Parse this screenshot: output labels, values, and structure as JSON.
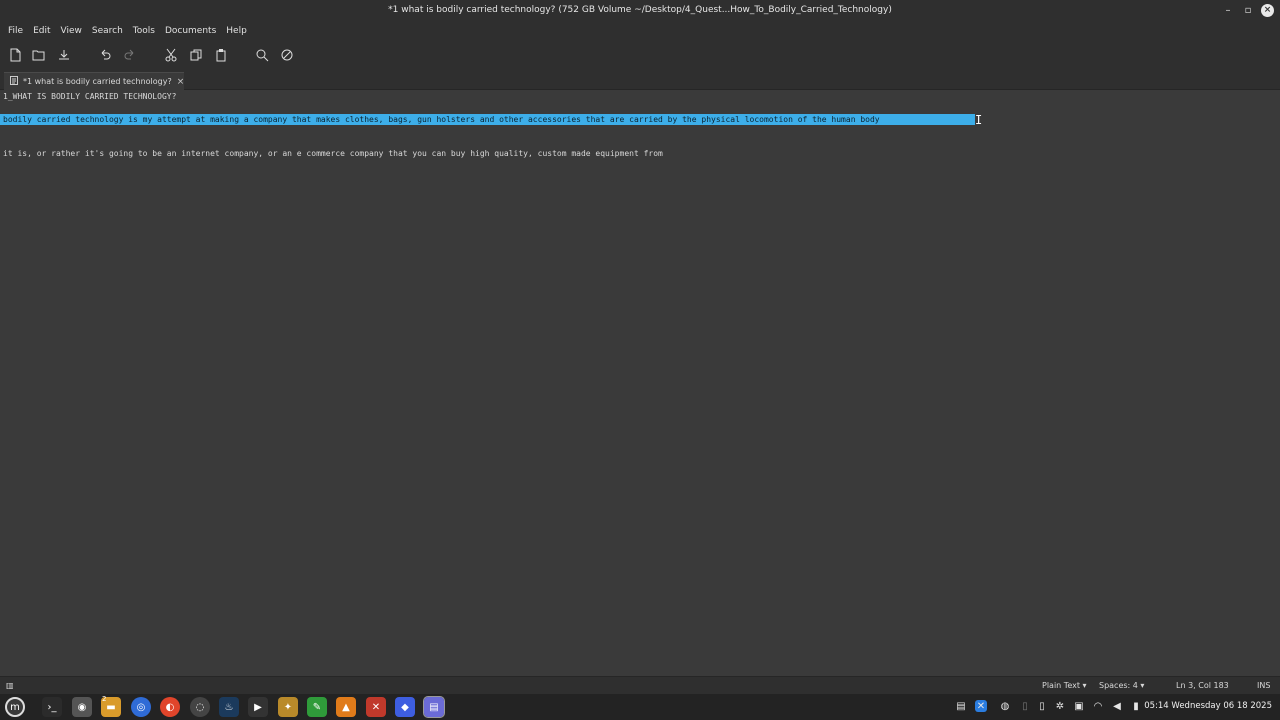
{
  "window": {
    "title": "*1 what is bodily carried technology? (752 GB Volume ~/Desktop/4_Quest...How_To_Bodily_Carried_Technology)"
  },
  "menu": [
    "File",
    "Edit",
    "View",
    "Search",
    "Tools",
    "Documents",
    "Help"
  ],
  "toolbar": {
    "icons": [
      "new-document-icon",
      "open-icon",
      "save-icon",
      "undo-icon",
      "redo-icon",
      "cut-icon",
      "copy-icon",
      "paste-icon",
      "find-icon",
      "clear-formatting-icon"
    ]
  },
  "tab": {
    "label": "*1 what is bodily carried technology?",
    "close": "×"
  },
  "editor": {
    "lines": [
      "1_WHAT IS BODILY CARRIED TECHNOLOGY?",
      "bodily carried technology is my attempt at making a company that makes clothes, bags, gun holsters and other accessories that are carried by the physical locomotion of the human body",
      "it is, or rather it's going to be an internet company, or an e commerce company that you can buy high quality, custom made equipment from"
    ],
    "selection_color": "#3daee9"
  },
  "status": {
    "syntax": "Plain Text",
    "spaces": "Spaces: 4",
    "position": "Ln 3, Col 183",
    "mode": "INS"
  },
  "taskbar": {
    "clock": "05:14 Wednesday 06 18 2025",
    "badge": "2"
  }
}
